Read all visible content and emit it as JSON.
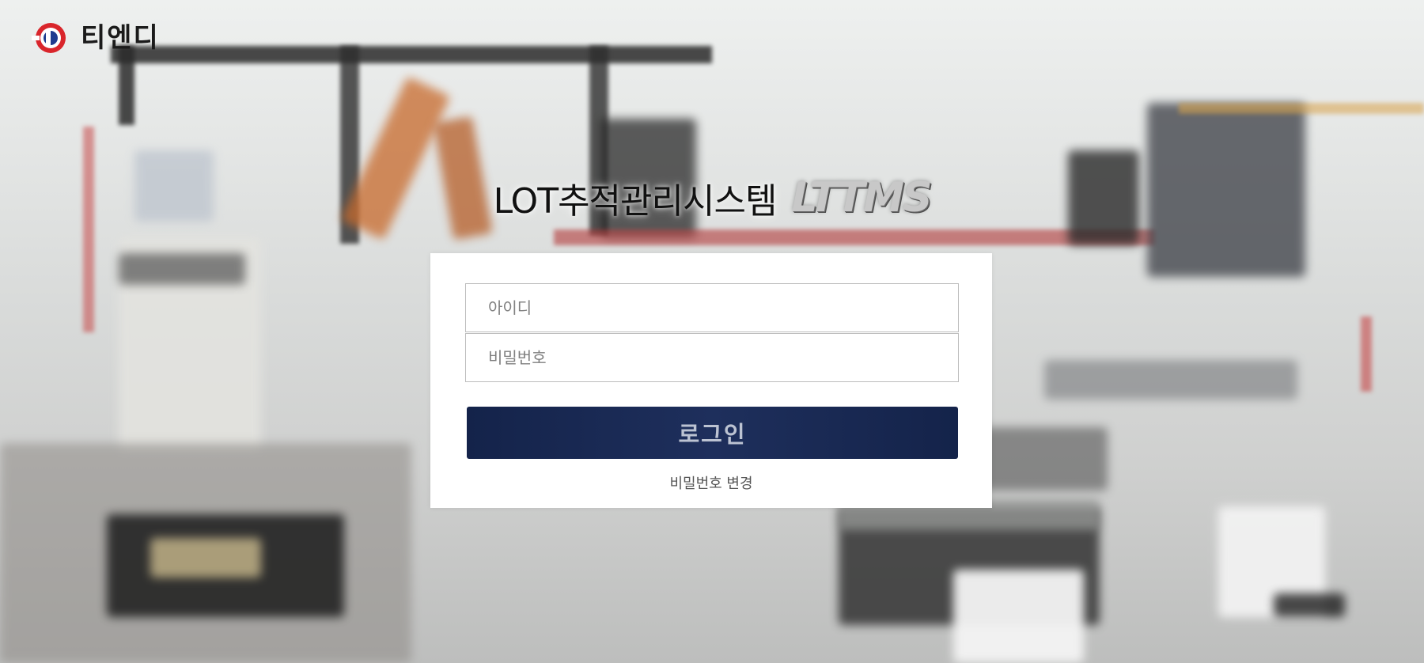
{
  "company": {
    "name": "티엔디",
    "brand_colors": {
      "ring": "#d9252b",
      "core": "#1f3b8f"
    }
  },
  "header": {
    "title": "LOT추적관리시스템",
    "brand": "LTTMS"
  },
  "login_form": {
    "id_placeholder": "아이디",
    "password_placeholder": "비밀번호",
    "login_label": "로그인",
    "change_password_label": "비밀번호 변경"
  },
  "theme": {
    "button_color": "#1a2a55",
    "card_background": "#ffffff"
  }
}
